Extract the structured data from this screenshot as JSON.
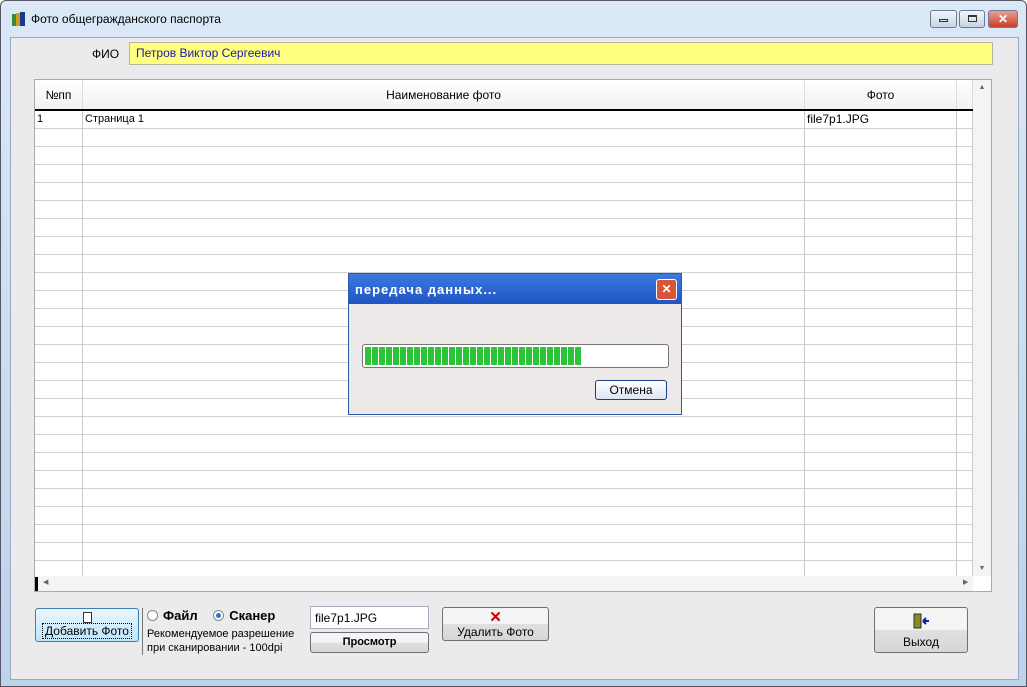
{
  "window": {
    "title": "Фото общегражданского паспорта"
  },
  "fio": {
    "label": "ФИО",
    "value": "Петров Виктор Сергеевич"
  },
  "grid": {
    "columns": [
      "№пп",
      "Наименование фото",
      "Фото"
    ],
    "rows": [
      {
        "num": "1",
        "name": "Страница 1",
        "photo": "file7p1.JPG"
      }
    ]
  },
  "dialog": {
    "title": "передача данных...",
    "progress_percent": 72,
    "cancel_label": "Отмена"
  },
  "bottom": {
    "add_label": "Добавить Фото",
    "radio_file": "Файл",
    "radio_scanner": "Сканер",
    "selected": "Сканер",
    "hint_line1": "Рекомендуемое разрешение",
    "hint_line2": "при сканировании - 100dpi",
    "file_value": "file7p1.JPG",
    "preview_label": "Просмотр",
    "delete_label": "Удалить Фото",
    "exit_label": "Выход"
  }
}
